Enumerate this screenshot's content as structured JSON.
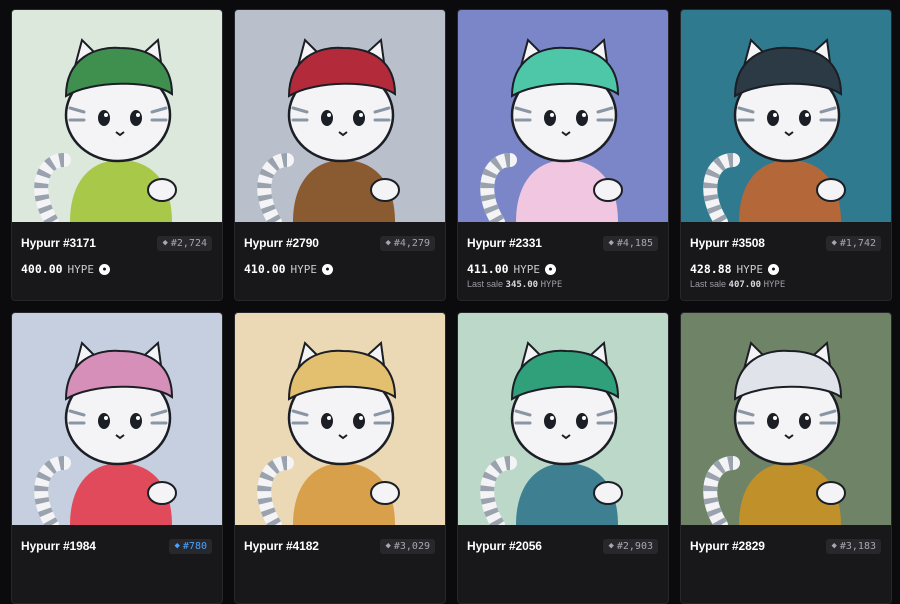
{
  "currency": "HYPE",
  "coin_icon": "hype-coin-icon",
  "rank_icon": "diamond-icon",
  "items": [
    {
      "name": "Hypurr #3171",
      "rank": "#2,724",
      "price": "400.00",
      "bg": "#dce8dc",
      "hat": "#3f8f4f",
      "accent": "#a8c84a",
      "rank_highlight": false
    },
    {
      "name": "Hypurr #2790",
      "rank": "#4,279",
      "price": "410.00",
      "bg": "#b9c0cc",
      "hat": "#b32b3a",
      "accent": "#8a5a30",
      "rank_highlight": false
    },
    {
      "name": "Hypurr #2331",
      "rank": "#4,185",
      "price": "411.00",
      "last_sale_label": "Last sale",
      "last_sale": "345.00",
      "bg": "#7b86c8",
      "hat": "#4ec7a8",
      "accent": "#f0c6e0",
      "rank_highlight": false
    },
    {
      "name": "Hypurr #3508",
      "rank": "#1,742",
      "price": "428.88",
      "last_sale_label": "Last sale",
      "last_sale": "407.00",
      "bg": "#2f7a8e",
      "hat": "#2b3a44",
      "accent": "#b4683a",
      "rank_highlight": false
    },
    {
      "name": "Hypurr #1984",
      "rank": "#780",
      "bg": "#c5cfe0",
      "hat": "#d68fb8",
      "accent": "#e04a5a",
      "rank_highlight": true
    },
    {
      "name": "Hypurr #4182",
      "rank": "#3,029",
      "bg": "#ebd8b4",
      "hat": "#e2c070",
      "accent": "#d8a04a",
      "rank_highlight": false
    },
    {
      "name": "Hypurr #2056",
      "rank": "#2,903",
      "bg": "#bcd8c8",
      "hat": "#2fa07a",
      "accent": "#3e7f92",
      "rank_highlight": false
    },
    {
      "name": "Hypurr #2829",
      "rank": "#3,183",
      "bg": "#6f8466",
      "hat": "#e0e4ea",
      "accent": "#c0902a",
      "rank_highlight": false
    }
  ]
}
